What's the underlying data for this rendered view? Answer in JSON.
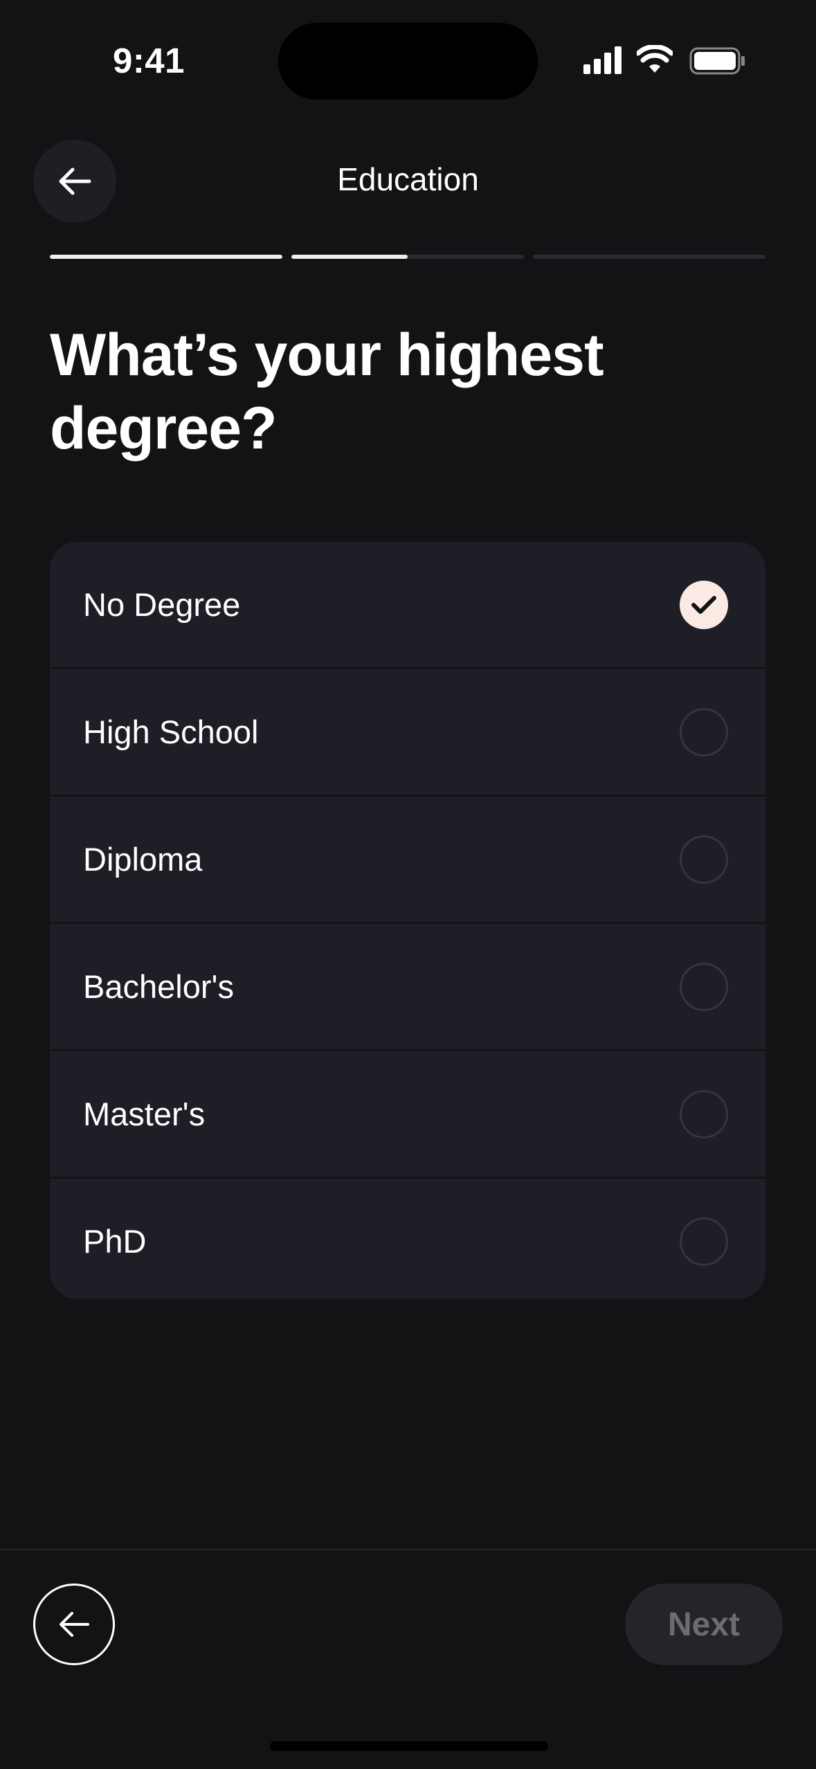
{
  "status_bar": {
    "time": "9:41"
  },
  "header": {
    "title": "Education",
    "back_icon": "arrow-left-icon"
  },
  "progress": {
    "segments": [
      1.0,
      0.5,
      0.0
    ]
  },
  "question": {
    "text": "What’s your highest degree?"
  },
  "options": [
    {
      "label": "No Degree",
      "selected": true
    },
    {
      "label": "High School",
      "selected": false
    },
    {
      "label": "Diploma",
      "selected": false
    },
    {
      "label": "Bachelor's",
      "selected": false
    },
    {
      "label": "Master's",
      "selected": false
    },
    {
      "label": "PhD",
      "selected": false
    }
  ],
  "footer": {
    "back_icon": "arrow-left-icon",
    "next_label": "Next",
    "next_enabled": false
  },
  "colors": {
    "background": "#131315",
    "card": "#1e1f26",
    "accent": "#fbe9e4",
    "progress_fill": "#f3ece8"
  }
}
